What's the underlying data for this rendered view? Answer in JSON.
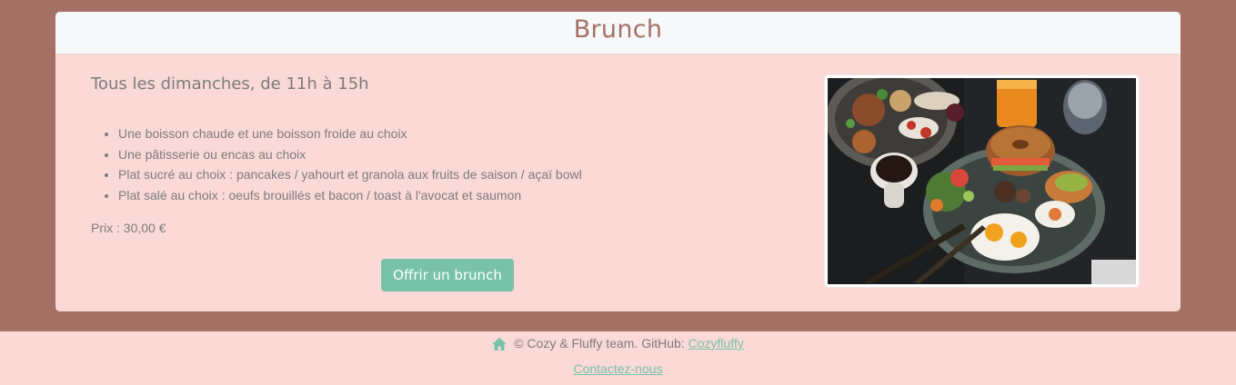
{
  "card": {
    "title": "Brunch",
    "subtitle": "Tous les dimanches, de 11h à 15h",
    "items": [
      "Une boisson chaude et une boisson froide au choix",
      "Une pâtisserie ou encas au choix",
      "Plat sucré au choix : pancakes / yahourt et granola aux fruits de saison / açaï bowl",
      "Plat salé au choix : oeufs brouillés et bacon / toast à l'avocat et saumon"
    ],
    "price": "Prix : 30,00 €",
    "button_label": "Offrir un brunch"
  },
  "footer": {
    "copyright": "© Cozy & Fluffy team. GitHub:",
    "github_link": "Cozyfluffy",
    "contact_link": "Contactez-nous",
    "home_icon": "home-icon"
  },
  "colors": {
    "background": "#a57165",
    "card": "#fbd9d6",
    "header": "#f7f8fa",
    "title": "#a57165",
    "accent": "#77c2a9",
    "text": "#7c7c7c"
  }
}
